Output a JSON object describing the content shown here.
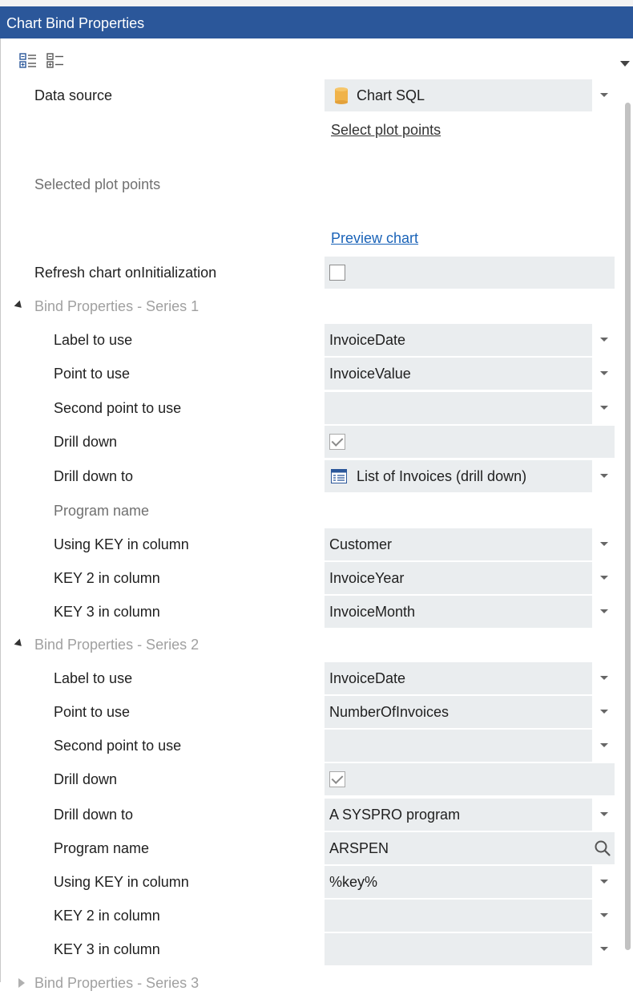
{
  "panel": {
    "title": "Chart Bind Properties"
  },
  "icons": {
    "toolbar_categorized": "categorized-view-icon",
    "toolbar_alphabetical": "alphabetical-view-icon",
    "data_source": "database-icon",
    "drill_target": "list-icon",
    "program_lookup": "search-icon"
  },
  "colors": {
    "titlebar_bg": "#2b579a",
    "value_bg": "#eaedef",
    "link_blue": "#1a63b8",
    "database_icon": "#f0b34a"
  },
  "top": {
    "data_source_label": "Data source",
    "data_source_value": "Chart SQL",
    "select_plot_points_link": "Select plot points",
    "selected_plot_points_label": "Selected plot points",
    "preview_chart_link": "Preview chart",
    "refresh_label": "Refresh chart onInitialization",
    "refresh_checked": false
  },
  "series1": {
    "title": "Bind Properties - Series 1",
    "label_to_use_label": "Label to use",
    "label_to_use_value": "InvoiceDate",
    "point_to_use_label": "Point to use",
    "point_to_use_value": "InvoiceValue",
    "second_point_label": "Second point to use",
    "second_point_value": "",
    "drill_down_label": "Drill down",
    "drill_down_checked": true,
    "drill_down_to_label": "Drill down to",
    "drill_down_to_value": "List of Invoices (drill down)",
    "program_name_label": "Program name",
    "using_key_label": "Using KEY in column",
    "using_key_value": "Customer",
    "key2_label": "KEY 2 in column",
    "key2_value": "InvoiceYear",
    "key3_label": "KEY 3 in column",
    "key3_value": "InvoiceMonth"
  },
  "series2": {
    "title": "Bind Properties - Series 2",
    "label_to_use_label": "Label to use",
    "label_to_use_value": "InvoiceDate",
    "point_to_use_label": "Point to use",
    "point_to_use_value": "NumberOfInvoices",
    "second_point_label": "Second point to use",
    "second_point_value": "",
    "drill_down_label": "Drill down",
    "drill_down_checked": true,
    "drill_down_to_label": "Drill down to",
    "drill_down_to_value": "A SYSPRO program",
    "program_name_label": "Program name",
    "program_name_value": "ARSPEN",
    "using_key_label": "Using KEY in column",
    "using_key_value": "%key%",
    "key2_label": "KEY 2 in column",
    "key2_value": "",
    "key3_label": "KEY 3 in column",
    "key3_value": ""
  },
  "series3": {
    "title": "Bind Properties - Series 3"
  }
}
